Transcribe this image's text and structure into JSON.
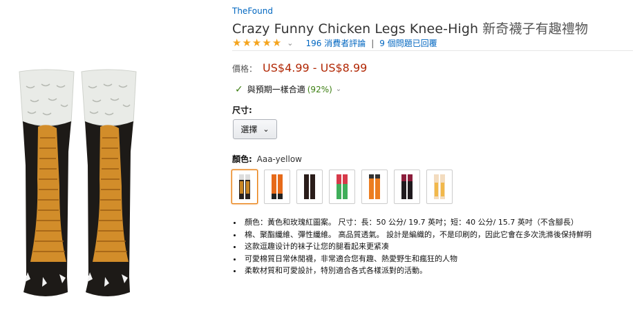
{
  "brand": "TheFound",
  "title": {
    "en": "Crazy Funny Chicken Legs Knee-High",
    "cn": "新奇襪子有趣禮物"
  },
  "rating": {
    "stars": 5,
    "reviews": "196 消費者評論",
    "questions": "9 個問題已回覆",
    "star_color": "#f4a41d"
  },
  "price": {
    "label": "價格：",
    "value": "US$4.99 - US$8.99",
    "color": "#b12704"
  },
  "fit": {
    "text": "與預期一樣合適",
    "pct": "(92%)"
  },
  "size": {
    "label": "尺寸:",
    "select_text": "選擇"
  },
  "color": {
    "label": "顏色:",
    "value": "Aaa-yellow",
    "swatches": [
      {
        "name": "yellow",
        "selected": true
      },
      {
        "name": "orange-black"
      },
      {
        "name": "black"
      },
      {
        "name": "green-red"
      },
      {
        "name": "orange"
      },
      {
        "name": "maroon-black"
      },
      {
        "name": "cream"
      }
    ]
  },
  "bullets": [
    "顏色：黃色和玫瑰紅圖案。 尺寸：長：50 公分/ 19.7 英吋；短：40 公分/ 15.7 英吋（不含腳長）",
    "棉、聚酯纖維、彈性纖維。 高品質透氣。 設計是編織的，不是印刷的，因此它會在多次洗滌後保持鮮明",
    "这款逗趣设计的袜子让您的腿看起来更紧凑",
    "可愛棉質日常休閒襪，非常適合您有趣、熱愛野生和瘋狂的人物",
    "柔軟材質和可愛設計，特別適合各式各樣派對的活動。"
  ]
}
